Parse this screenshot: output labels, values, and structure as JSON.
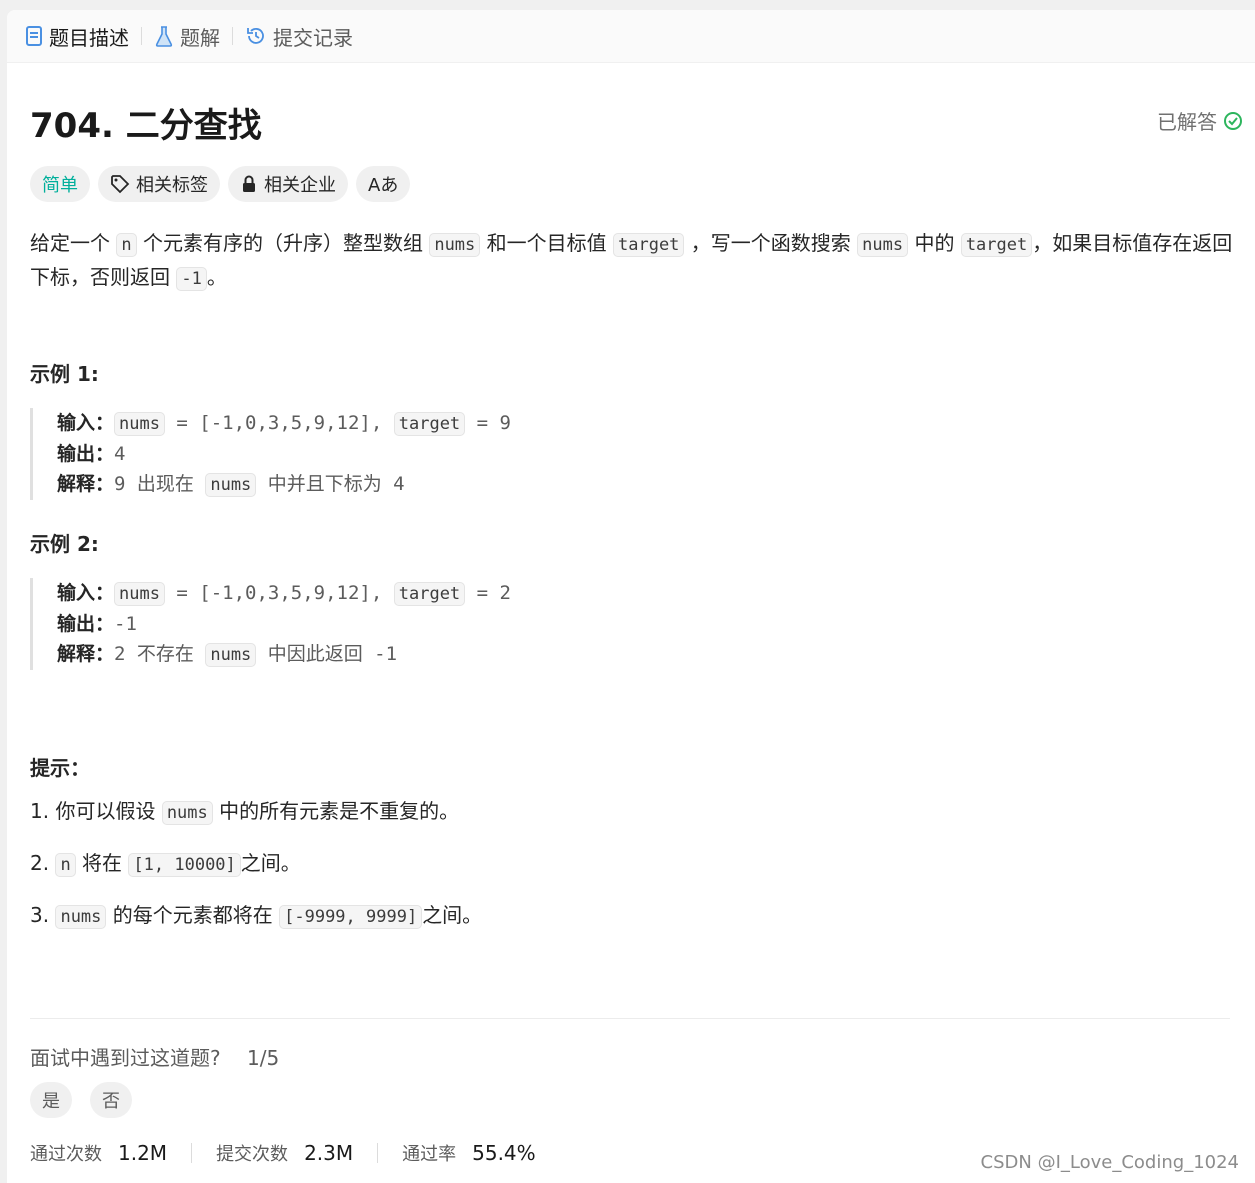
{
  "tabs": [
    {
      "label": "题目描述",
      "icon": "document-icon"
    },
    {
      "label": "题解",
      "icon": "flask-icon"
    },
    {
      "label": "提交记录",
      "icon": "history-icon"
    }
  ],
  "problem": {
    "title": "704. 二分查找",
    "status": "已解答",
    "tags": {
      "difficulty": "简单",
      "related_tags": "相关标签",
      "related_companies": "相关企业",
      "translate": "Aあ"
    },
    "description": {
      "t1": "给定一个 ",
      "c1": "n",
      "t2": " 个元素有序的（升序）整型数组 ",
      "c2": "nums",
      "t3": " 和一个目标值 ",
      "c3": "target",
      "t4": " ，写一个函数搜索 ",
      "c4": "nums",
      "t5": " 中的 ",
      "c5": "target",
      "t6": "，如果目标值存在返回下标，否则返回 ",
      "c6": "-1",
      "t7": "。"
    }
  },
  "examples": [
    {
      "title": "示例 1:",
      "input_label": "输入：",
      "input_a": "nums",
      "input_b": " = [-1,0,3,5,9,12], ",
      "input_c": "target",
      "input_d": " = 9",
      "output_label": "输出：",
      "output": "4",
      "explain_label": "解释：",
      "explain_a": "9 出现在 ",
      "explain_code": "nums",
      "explain_b": " 中并且下标为 4"
    },
    {
      "title": "示例 2:",
      "input_label": "输入：",
      "input_a": "nums",
      "input_b": " = [-1,0,3,5,9,12], ",
      "input_c": "target",
      "input_d": " = 2",
      "output_label": "输出：",
      "output": "-1",
      "explain_label": "解释：",
      "explain_a": "2 不存在 ",
      "explain_code": "nums",
      "explain_b": " 中因此返回 -1"
    }
  ],
  "hints": {
    "title": "提示：",
    "items": [
      {
        "num": "1. ",
        "a": "你可以假设 ",
        "code": "nums",
        "b": " 中的所有元素是不重复的。"
      },
      {
        "num": "2. ",
        "code0": "n",
        "a": " 将在 ",
        "code": "[1, 10000]",
        "b": "之间。"
      },
      {
        "num": "3. ",
        "code0": "nums",
        "a": " 的每个元素都将在 ",
        "code": "[-9999, 9999]",
        "b": "之间。"
      }
    ]
  },
  "interview": {
    "question": "面试中遇到过这道题?",
    "fraction": "1/5",
    "yes": "是",
    "no": "否"
  },
  "stats": {
    "accepted_label": "通过次数",
    "accepted": "1.2M",
    "submissions_label": "提交次数",
    "submissions": "2.3M",
    "rate_label": "通过率",
    "rate": "55.4%"
  },
  "watermark": "CSDN @I_Love_Coding_1024",
  "colors": {
    "easy": "#00af9b",
    "solved": "#2db55d",
    "tab_icon": "#4a90e2"
  }
}
